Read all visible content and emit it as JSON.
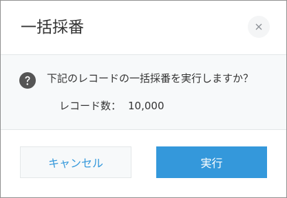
{
  "dialog": {
    "title": "一括採番",
    "close_icon": "close-icon"
  },
  "body": {
    "question_icon": "question-circle-icon",
    "message": "下記のレコードの一括採番を実行しますか？",
    "record_count_label": "レコード数：",
    "record_count_value": "10,000"
  },
  "footer": {
    "cancel_label": "キャンセル",
    "run_label": "実行"
  },
  "colors": {
    "accent": "#3498db",
    "text": "#333333",
    "body_background": "#f7f9fa",
    "border": "#e3e7e8"
  }
}
